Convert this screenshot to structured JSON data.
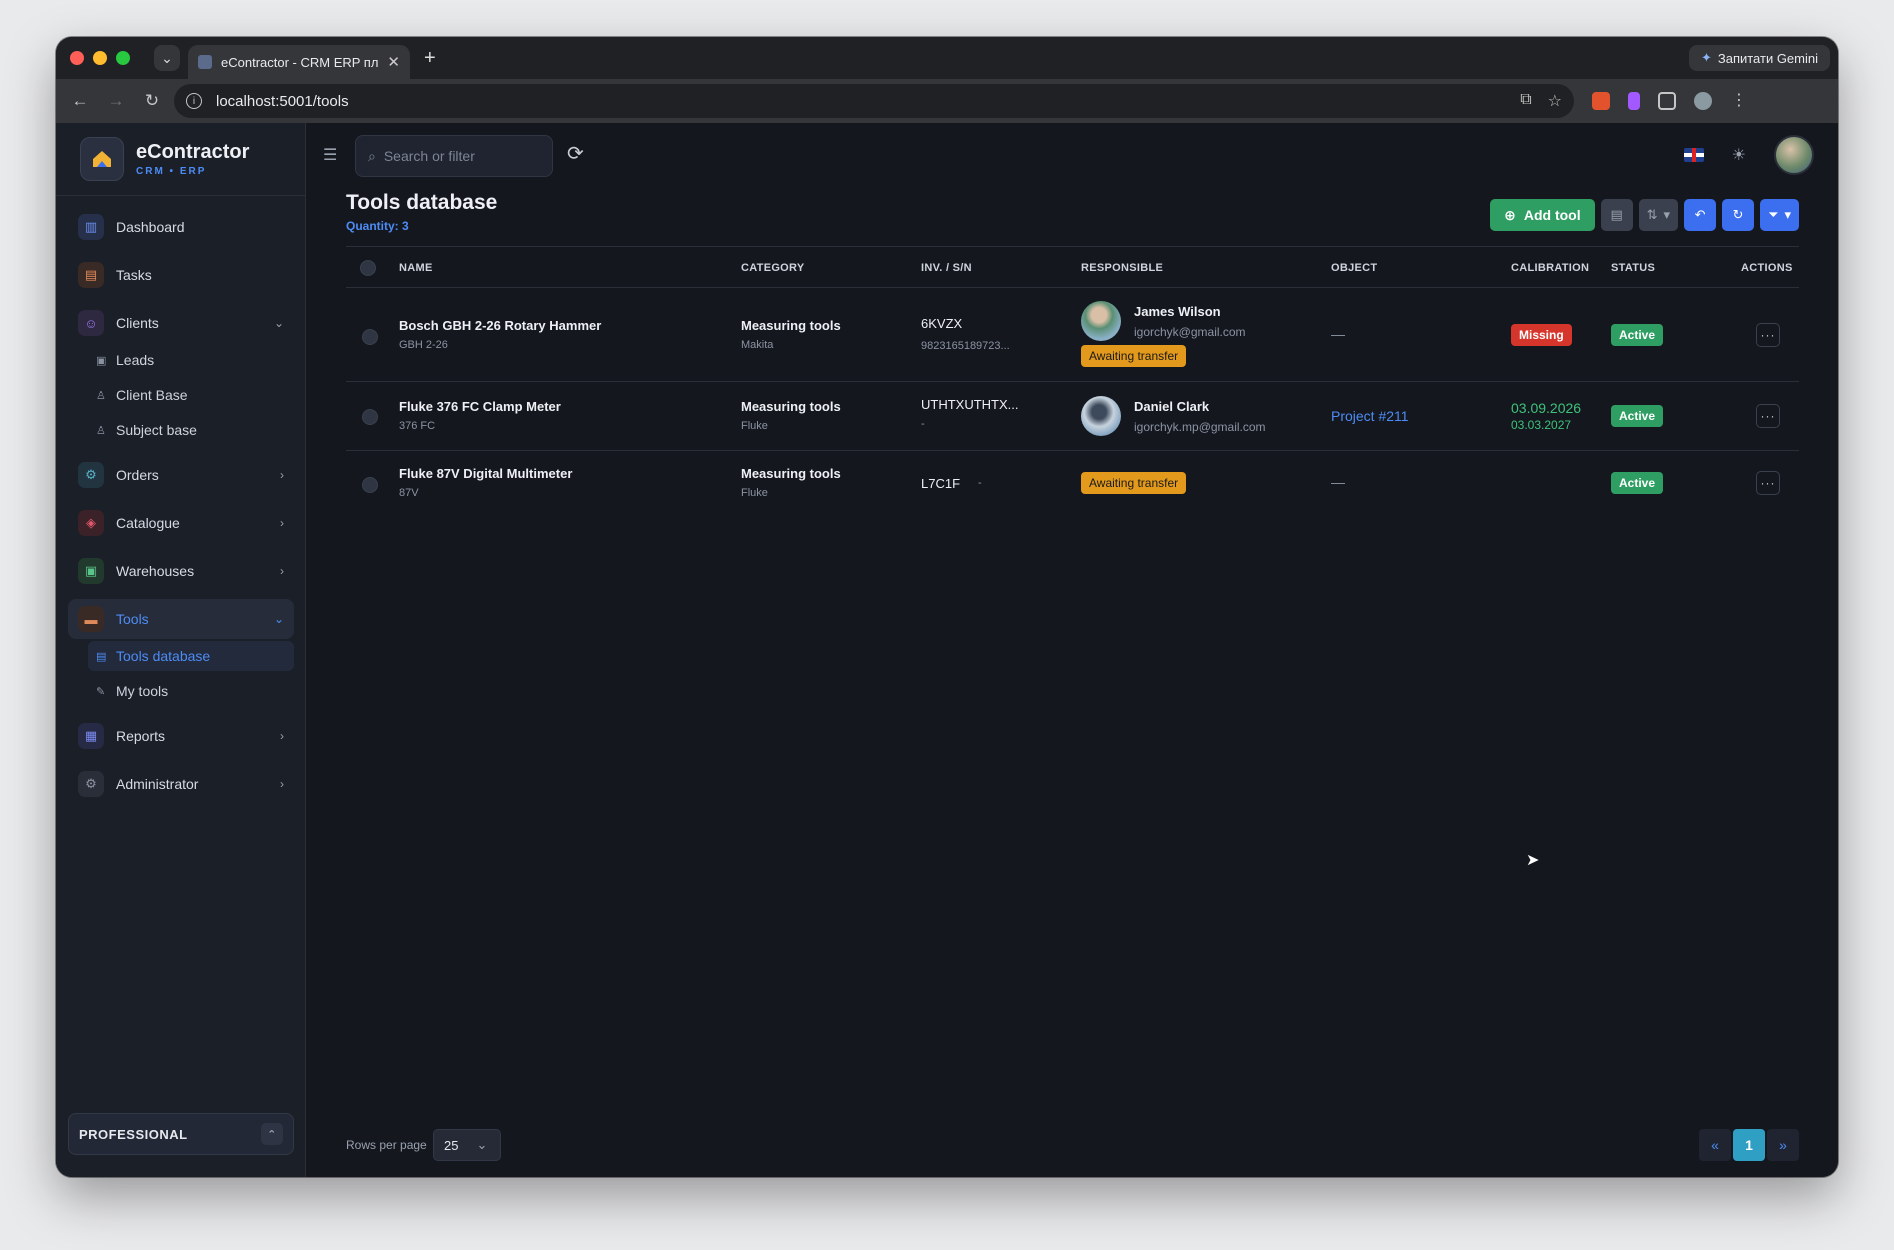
{
  "browser": {
    "tab_title": "eContractor - CRM ERP платф",
    "url": "localhost:5001/tools",
    "gemini_label": "Запитати Gemini"
  },
  "brand": {
    "name": "eContractor",
    "subtitle": "CRM • ERP"
  },
  "sidebar": {
    "items": [
      {
        "label": "Dashboard",
        "icon": "bar-chart-icon",
        "color": "#4d6cc4"
      },
      {
        "label": "Tasks",
        "icon": "clipboard-icon",
        "color": "#c46a3a"
      },
      {
        "label": "Clients",
        "icon": "users-icon",
        "color": "#7a4fc4",
        "sub": [
          "Leads",
          "Client Base",
          "Subject base"
        ]
      },
      {
        "label": "Orders",
        "icon": "gear-icon",
        "color": "#3a8a9e"
      },
      {
        "label": "Catalogue",
        "icon": "box-icon",
        "color": "#c4424e"
      },
      {
        "label": "Warehouses",
        "icon": "warehouse-icon",
        "color": "#3a9e6a"
      },
      {
        "label": "Tools",
        "icon": "toolbox-icon",
        "color": "#c46a3a",
        "sub": [
          "Tools database",
          "My tools"
        ]
      },
      {
        "label": "Reports",
        "icon": "report-icon",
        "color": "#5a6ac4"
      },
      {
        "label": "Administrator",
        "icon": "settings-icon",
        "color": "#6a7080"
      }
    ],
    "plan_label": "PROFESSIONAL"
  },
  "topbar": {
    "search_placeholder": "Search or filter"
  },
  "page": {
    "title": "Tools database",
    "quantity": "Quantity: 3",
    "add_label": "Add tool"
  },
  "table": {
    "headers": [
      "NAME",
      "CATEGORY",
      "INV. / S/N",
      "RESPONSIBLE",
      "OBJECT",
      "CALIBRATION",
      "STATUS",
      "ACTIONS"
    ],
    "rows": [
      {
        "name": "Bosch GBH 2-26 Rotary Hammer",
        "model": "GBH 2-26",
        "category": "Measuring tools",
        "brand": "Makita",
        "inv": "6KVZX",
        "sn": "9823165189723...",
        "resp_name": "James Wilson",
        "resp_email": "igorchyk@gmail.com",
        "transfer": "Awaiting transfer",
        "object": "—",
        "calibration": "Missing",
        "status": "Active"
      },
      {
        "name": "Fluke 376 FC Clamp Meter",
        "model": "376 FC",
        "category": "Measuring tools",
        "brand": "Fluke",
        "inv": "UTHTXUTHTX...",
        "sn": "-",
        "resp_name": "Daniel Clark",
        "resp_email": "igorchyk.mp@gmail.com",
        "object": "Project #211",
        "cal_date1": "03.09.2026",
        "cal_date2": "03.03.2027",
        "status": "Active"
      },
      {
        "name": "Fluke 87V Digital Multimeter",
        "model": "87V",
        "category": "Measuring tools",
        "brand": "Fluke",
        "inv": "L7C1F",
        "sn": "-",
        "transfer": "Awaiting transfer",
        "object": "—",
        "status": "Active"
      }
    ]
  },
  "footer": {
    "rows_label": "Rows per page",
    "rows_value": "25",
    "page": "1",
    "prev": "«",
    "next": "»"
  }
}
